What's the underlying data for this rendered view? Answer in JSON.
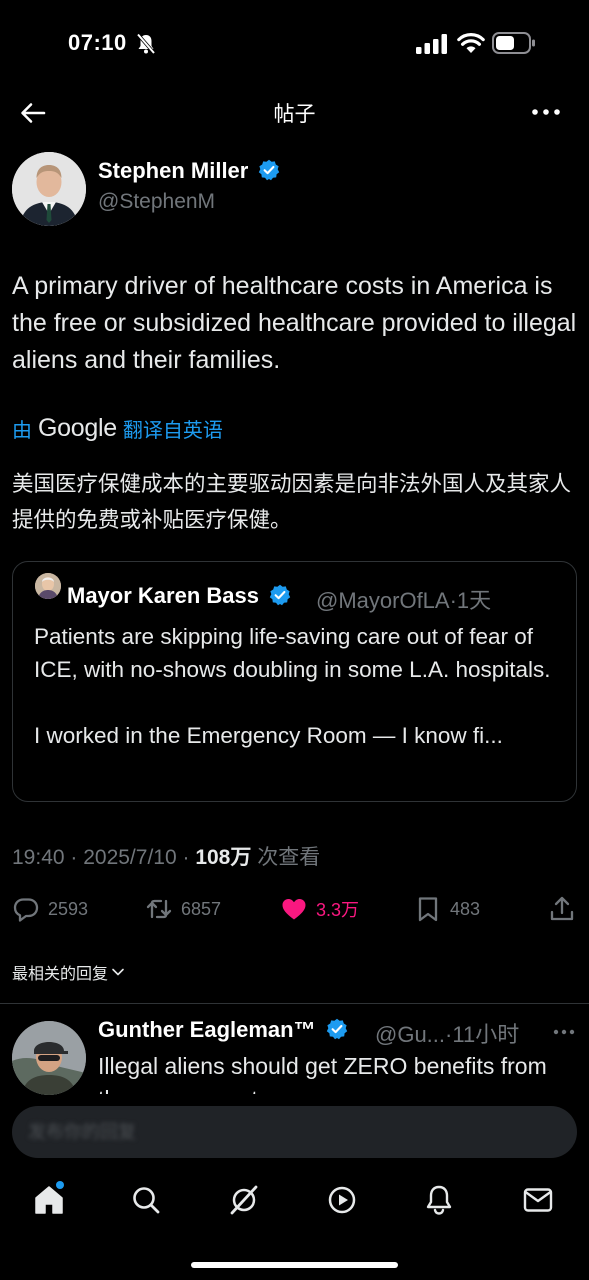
{
  "status_bar": {
    "time": "07:10"
  },
  "header": {
    "title": "帖子"
  },
  "post": {
    "author_name": "Stephen Miller",
    "author_handle": "@StephenM",
    "text": "A primary driver of healthcare costs in America is the free or subsidized healthcare provided to illegal aliens and their families.",
    "translate_prefix": "由",
    "translate_brand": "Google",
    "translate_suffix": "翻译自英语",
    "translated_text": "美国医疗保健成本的主要驱动因素是向非法外国人及其家人提供的免费或补贴医疗保健。",
    "timestamp": "19:40 · 2025/7/10 · ",
    "views_count": "108万",
    "views_label": " 次查看"
  },
  "quote": {
    "author_name": "Mayor Karen Bass",
    "author_handle": "@MayorOfLA",
    "time": "·1天",
    "para1": "Patients are skipping life-saving care out of fear of ICE, with no-shows doubling in some L.A. hospitals.",
    "para2": "I worked in the Emergency Room — I know fi..."
  },
  "actions": {
    "replies": "2593",
    "reposts": "6857",
    "likes": "3.3万",
    "bookmarks": "483"
  },
  "sort_label": "最相关的回复",
  "reply": {
    "author_name": "Gunther Eagleman™",
    "author_handle": "@Gu...",
    "time": "·11小时",
    "text": "Illegal aliens should get ZERO benefits from the government"
  },
  "compose": {
    "placeholder": "发布你的回复"
  },
  "colors": {
    "accent": "#1d9bf0",
    "like": "#f91880",
    "secondary_text": "#71767b",
    "background": "#000000"
  },
  "icons": [
    "back-arrow-icon",
    "more-icon",
    "verified-icon",
    "reply-icon",
    "repost-icon",
    "heart-icon",
    "bookmark-icon",
    "share-icon",
    "home-icon",
    "search-icon",
    "grok-icon",
    "video-icon",
    "notifications-icon",
    "messages-icon"
  ]
}
